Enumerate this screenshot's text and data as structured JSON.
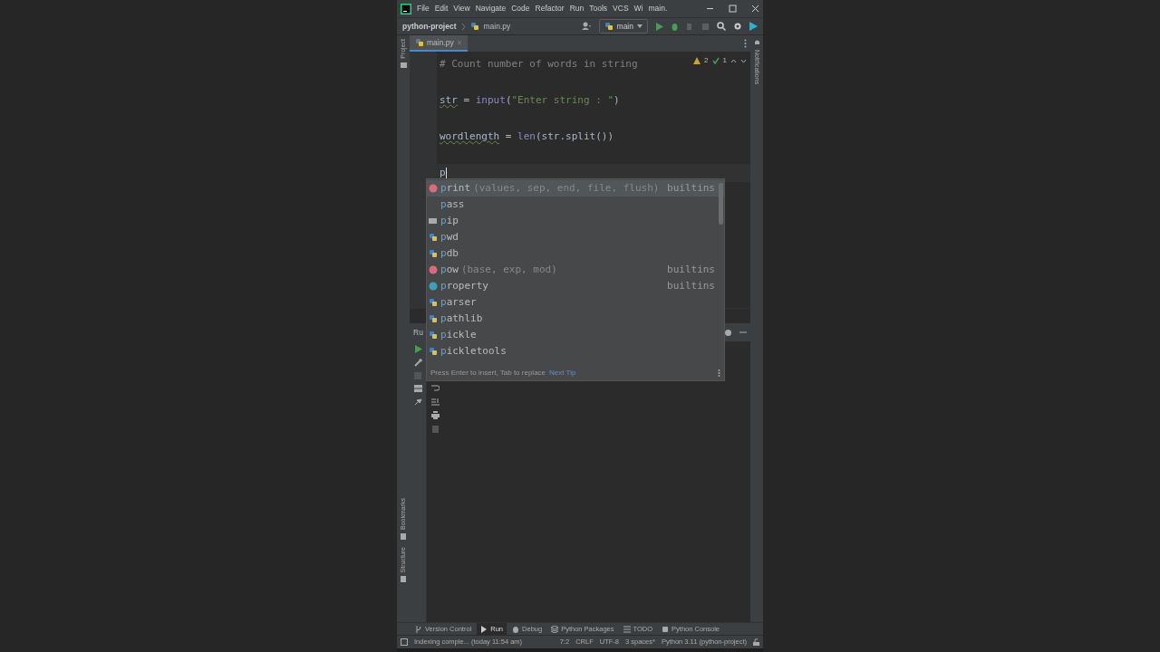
{
  "title_bar": {
    "menus": [
      "File",
      "Edit",
      "View",
      "Navigate",
      "Code",
      "Refactor",
      "Run",
      "Tools",
      "VCS",
      "Wi"
    ],
    "title": "main."
  },
  "nav_bar": {
    "project": "python-project",
    "file": "main.py",
    "run_config": "main"
  },
  "tabs": [
    {
      "label": "main.py",
      "selected": true
    }
  ],
  "side_stripe": {
    "top": "Project",
    "bottom": [
      "Bookmarks",
      "Structure"
    ],
    "right": "Notifications"
  },
  "inspections": {
    "warnings": "2",
    "typos": "1"
  },
  "code_lines": [
    {
      "tokens": [
        {
          "kind": "comment",
          "text": "# Count number of words in string"
        }
      ]
    },
    {
      "tokens": [
        {
          "kind": "var",
          "text": "str"
        },
        {
          "kind": "op",
          "text": " = "
        },
        {
          "kind": "builtin",
          "text": "input"
        },
        {
          "kind": "op",
          "text": "("
        },
        {
          "kind": "string",
          "text": "\"Enter string : \""
        },
        {
          "kind": "op",
          "text": ")"
        }
      ]
    },
    {
      "tokens": [
        {
          "kind": "var",
          "text": "wordlength"
        },
        {
          "kind": "op",
          "text": " = "
        },
        {
          "kind": "builtin",
          "text": "len"
        },
        {
          "kind": "op",
          "text": "(str.split())"
        }
      ]
    },
    {
      "tokens": [
        {
          "kind": "op",
          "text": "p"
        }
      ],
      "caret": true
    }
  ],
  "completion": {
    "items": [
      {
        "kind": "function",
        "match": "p",
        "rest": "rint",
        "params": "(values, sep, end, file, flush)",
        "source": "builtins",
        "selected": true
      },
      {
        "kind": "keyword",
        "match": "p",
        "rest": "ass",
        "selected": false
      },
      {
        "kind": "package",
        "match": "p",
        "rest": "ip",
        "selected": false
      },
      {
        "kind": "module",
        "match": "p",
        "rest": "wd",
        "selected": false
      },
      {
        "kind": "module",
        "match": "p",
        "rest": "db",
        "selected": false
      },
      {
        "kind": "function",
        "match": "p",
        "rest": "ow",
        "params": "(base, exp, mod)",
        "source": "builtins",
        "selected": false
      },
      {
        "kind": "class",
        "match": "p",
        "rest": "roperty",
        "source": "builtins",
        "selected": false
      },
      {
        "kind": "module",
        "match": "p",
        "rest": "arser",
        "selected": false
      },
      {
        "kind": "module",
        "match": "p",
        "rest": "athlib",
        "selected": false
      },
      {
        "kind": "module",
        "match": "p",
        "rest": "ickle",
        "selected": false
      },
      {
        "kind": "module",
        "match": "p",
        "rest": "ickletools",
        "selected": false
      }
    ],
    "hint": "Press Enter to insert, Tab to replace",
    "tip_link": "Next Tip"
  },
  "run_panel": {
    "title": "Ru"
  },
  "tool_windows": [
    {
      "label": "Version Control",
      "selected": false
    },
    {
      "label": "Run",
      "selected": true
    },
    {
      "label": "Debug",
      "selected": false
    },
    {
      "label": "Python Packages",
      "selected": false
    },
    {
      "label": "TODO",
      "selected": false
    },
    {
      "label": "Python Console",
      "selected": false
    }
  ],
  "status_bar": {
    "message": "Indexing comple... (today 11:54 am)",
    "items": [
      "7:2",
      "CRLF",
      "UTF-8",
      "3 spaces*",
      "Python 3.11 (python-project)"
    ]
  }
}
